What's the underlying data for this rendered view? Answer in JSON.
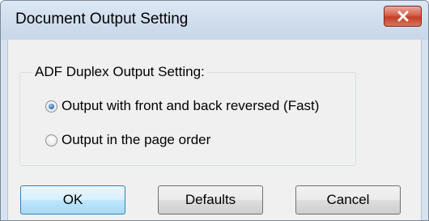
{
  "window": {
    "title": "Document Output Setting"
  },
  "group": {
    "label": "ADF Duplex Output Setting:",
    "options": [
      {
        "label": "Output with front and back reversed (Fast)",
        "selected": true
      },
      {
        "label": "Output in the page order",
        "selected": false
      }
    ]
  },
  "buttons": {
    "ok": "OK",
    "defaults": "Defaults",
    "cancel": "Cancel"
  },
  "icons": {
    "close": "close-icon"
  },
  "colors": {
    "close_button": "#c43e27",
    "default_button_border": "#3c7fb1",
    "radio_selected": "#3c78c0"
  }
}
